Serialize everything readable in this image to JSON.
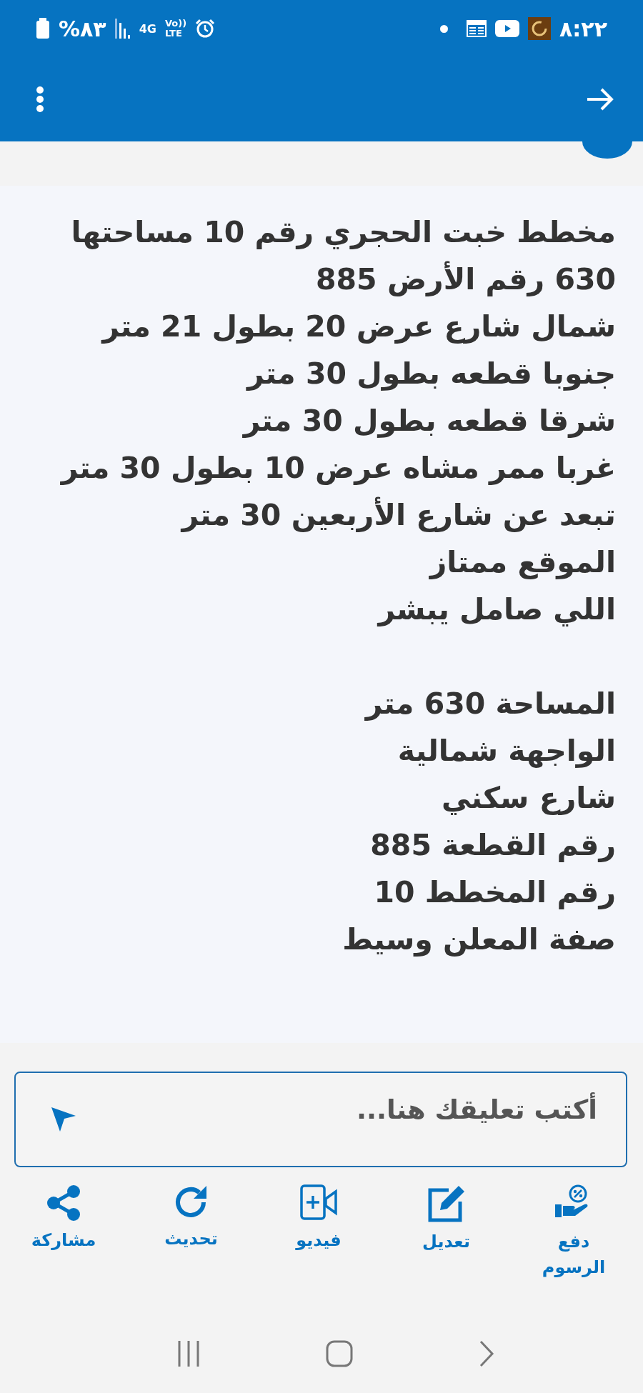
{
  "status_bar": {
    "battery": "%٨٣",
    "network": "4G",
    "volte": [
      "Vo))",
      "LTE"
    ],
    "time": "٨:٢٢"
  },
  "description": {
    "paragraphs": [
      [
        "مخطط خبت الحجري رقم 10 مساحتها",
        "630 رقم الأرض 885",
        "شمال شارع عرض 20 بطول 21 متر",
        "جنوبا قطعه بطول 30 متر",
        "شرقا قطعه بطول 30 متر",
        "غربا ممر مشاه عرض 10 بطول 30 متر",
        "تبعد عن شارع الأربعين 30 متر",
        "الموقع ممتاز",
        "اللي صامل يبشر"
      ],
      [
        "المساحة 630 متر",
        "الواجهة شمالية",
        "شارع سكني",
        "رقم القطعة 885",
        "رقم المخطط 10",
        "صفة المعلن وسيط"
      ]
    ]
  },
  "comment": {
    "placeholder": "أكتب تعليقك هنا..."
  },
  "actions": [
    {
      "kind": "fees",
      "label": "دفع الرسوم"
    },
    {
      "kind": "edit",
      "label": "تعديل"
    },
    {
      "kind": "video",
      "label": "فيديو"
    },
    {
      "kind": "refresh",
      "label": "تحديث"
    },
    {
      "kind": "share",
      "label": "مشاركة"
    }
  ]
}
